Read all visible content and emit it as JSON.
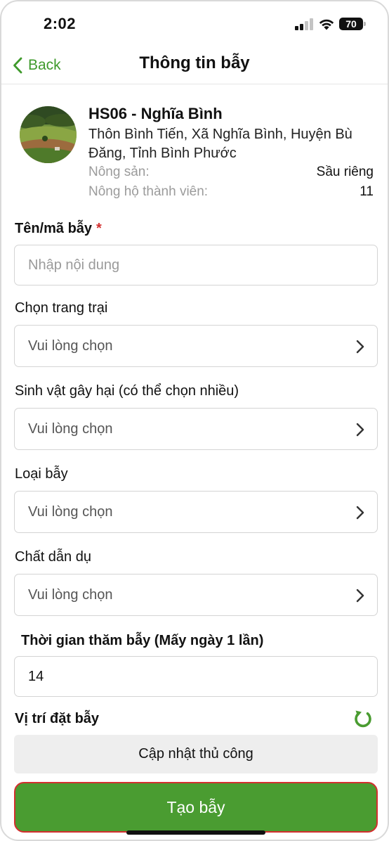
{
  "status_bar": {
    "time": "2:02",
    "battery": "70"
  },
  "nav": {
    "back_label": "Back",
    "title": "Thông tin bẫy"
  },
  "farm": {
    "name": "HS06 - Nghĩa Bình",
    "address": "Thôn Bình Tiến, Xã Nghĩa Bình, Huyện Bù Đăng, Tỉnh Bình Phước",
    "crop_label": "Nông sản:",
    "crop_value": "Sầu riêng",
    "members_label": "Nông hộ thành viên:",
    "members_value": "11"
  },
  "form": {
    "trap_name": {
      "label": "Tên/mã bẫy",
      "required_mark": "*",
      "placeholder": "Nhập nội dung",
      "value": ""
    },
    "farm_select": {
      "label": "Chọn trang trại",
      "value": "Vui lòng chọn"
    },
    "pest_select": {
      "label": "Sinh vật gây hại (có thể chọn nhiều)",
      "value": "Vui lòng chọn"
    },
    "trap_type_select": {
      "label": "Loại bẫy",
      "value": "Vui lòng chọn"
    },
    "lure_select": {
      "label": "Chất dẫn dụ",
      "value": "Vui lòng chọn"
    },
    "visit_interval": {
      "label": "Thời gian thăm bẫy (Mấy ngày 1 lần)",
      "value": "14"
    },
    "location": {
      "label": "Vị trí đặt bẫy",
      "manual_button": "Cập nhật thủ công"
    }
  },
  "actions": {
    "create_button": "Tạo bẫy"
  },
  "colors": {
    "accent_green": "#4a9c31",
    "link_green": "#3f9a2c",
    "required_red": "#d32f2f",
    "placeholder_gray": "#9a9a9a"
  },
  "icons": {
    "back": "chevron-left-icon",
    "select_arrow": "chevron-right-icon",
    "refresh": "refresh-icon"
  }
}
